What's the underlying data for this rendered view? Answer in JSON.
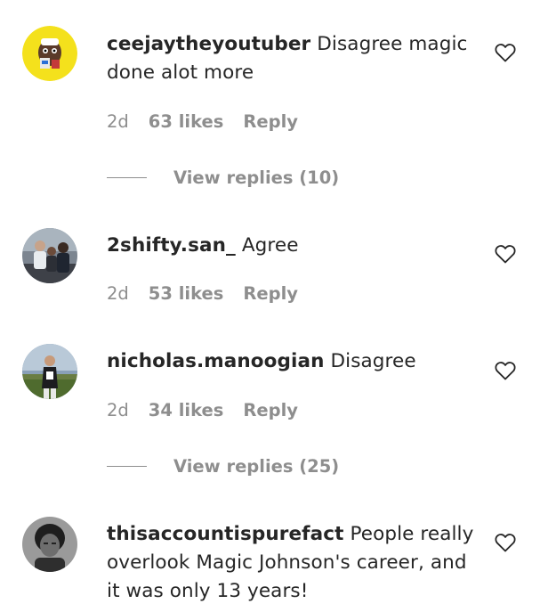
{
  "comments": [
    {
      "username": "ceejaytheyoutuber",
      "text": "Disagree magic done alot more",
      "time": "2d",
      "likes": "63 likes",
      "reply": "Reply",
      "view_replies": "View replies (10)",
      "avatar_bg": "#f4e11c"
    },
    {
      "username": "2shifty.san_",
      "text": "Agree",
      "time": "2d",
      "likes": "53 likes",
      "reply": "Reply",
      "avatar_bg": "#5b6470"
    },
    {
      "username": "nicholas.manoogian",
      "text": "Disagree",
      "time": "2d",
      "likes": "34 likes",
      "reply": "Reply",
      "view_replies": "View replies (25)",
      "avatar_bg": "#6f8a4a"
    },
    {
      "username": "thisaccountispurefact",
      "text": "People really overlook Magic Johnson's career, and it was only 13 years!",
      "avatar_bg": "#3a3a3a"
    }
  ],
  "colors": {
    "primary_text": "#262626",
    "secondary_text": "#8e8e8e"
  },
  "icons": {
    "like": "heart-outline-icon"
  }
}
